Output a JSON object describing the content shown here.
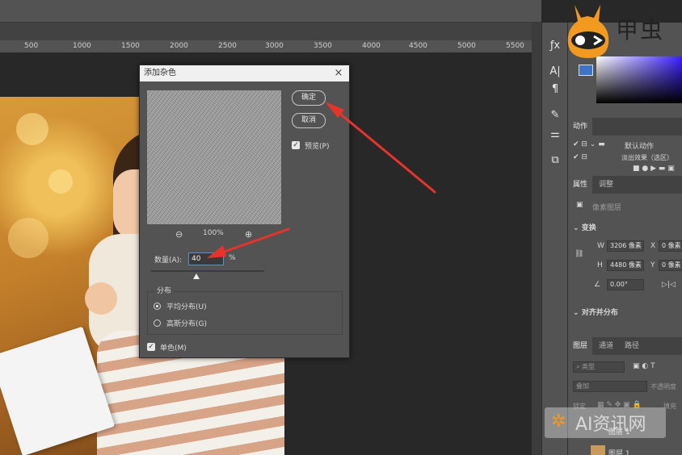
{
  "ruler": {
    "marks": [
      "500",
      "1000",
      "1500",
      "2000",
      "2500",
      "3000",
      "3500",
      "4000",
      "4500",
      "5000",
      "5500"
    ]
  },
  "dialog": {
    "title": "添加杂色",
    "close": "×",
    "ok_label": "确定",
    "cancel_label": "取消",
    "preview_label": "预览(P)",
    "zoom_out": "⊖",
    "zoom_level": "100%",
    "zoom_in": "⊕",
    "amount_label": "数量(A):",
    "amount_value": "40",
    "amount_unit": "%",
    "amount_slider_fraction": 0.4,
    "distribution_label": "分布",
    "uniform_label": "平均分布(U)",
    "gaussian_label": "高斯分布(G)",
    "mono_label": "单色(M)",
    "preview_checked": true,
    "mono_checked": true,
    "selected_distribution": "uniform"
  },
  "panels": {
    "actions_tab": "动作",
    "actions_item1": "默认动作",
    "actions_item2": "淡出效果（选区）",
    "props_tab": "属性",
    "adjust_tab": "调整",
    "pixel_layer": "像素图层",
    "transform_label": "变换",
    "w_label": "W",
    "w_value": "3206 像素",
    "x_label": "X",
    "x_value": "0 像素",
    "h_label": "H",
    "h_value": "4480 像素",
    "y_label": "Y",
    "y_value": "0 像素",
    "angle_value": "0.00°",
    "align_label": "对齐并分布",
    "layers_tab": "图层",
    "channels_tab": "通道",
    "paths_tab": "路径",
    "kind_label": "类型",
    "blend_label": "叠加",
    "opacity_label": "不透明度",
    "lock_label": "锁定",
    "fill_label": "填充",
    "layer_name1": "图层 1",
    "layer_name2": "图层 1"
  },
  "logo": {
    "text": "甲虫"
  },
  "watermark": {
    "text": "AI资讯网"
  },
  "colors": {
    "arrow": "#e8332b",
    "foreground": "#3f73c7",
    "accent_border": "#5a8fd8"
  }
}
